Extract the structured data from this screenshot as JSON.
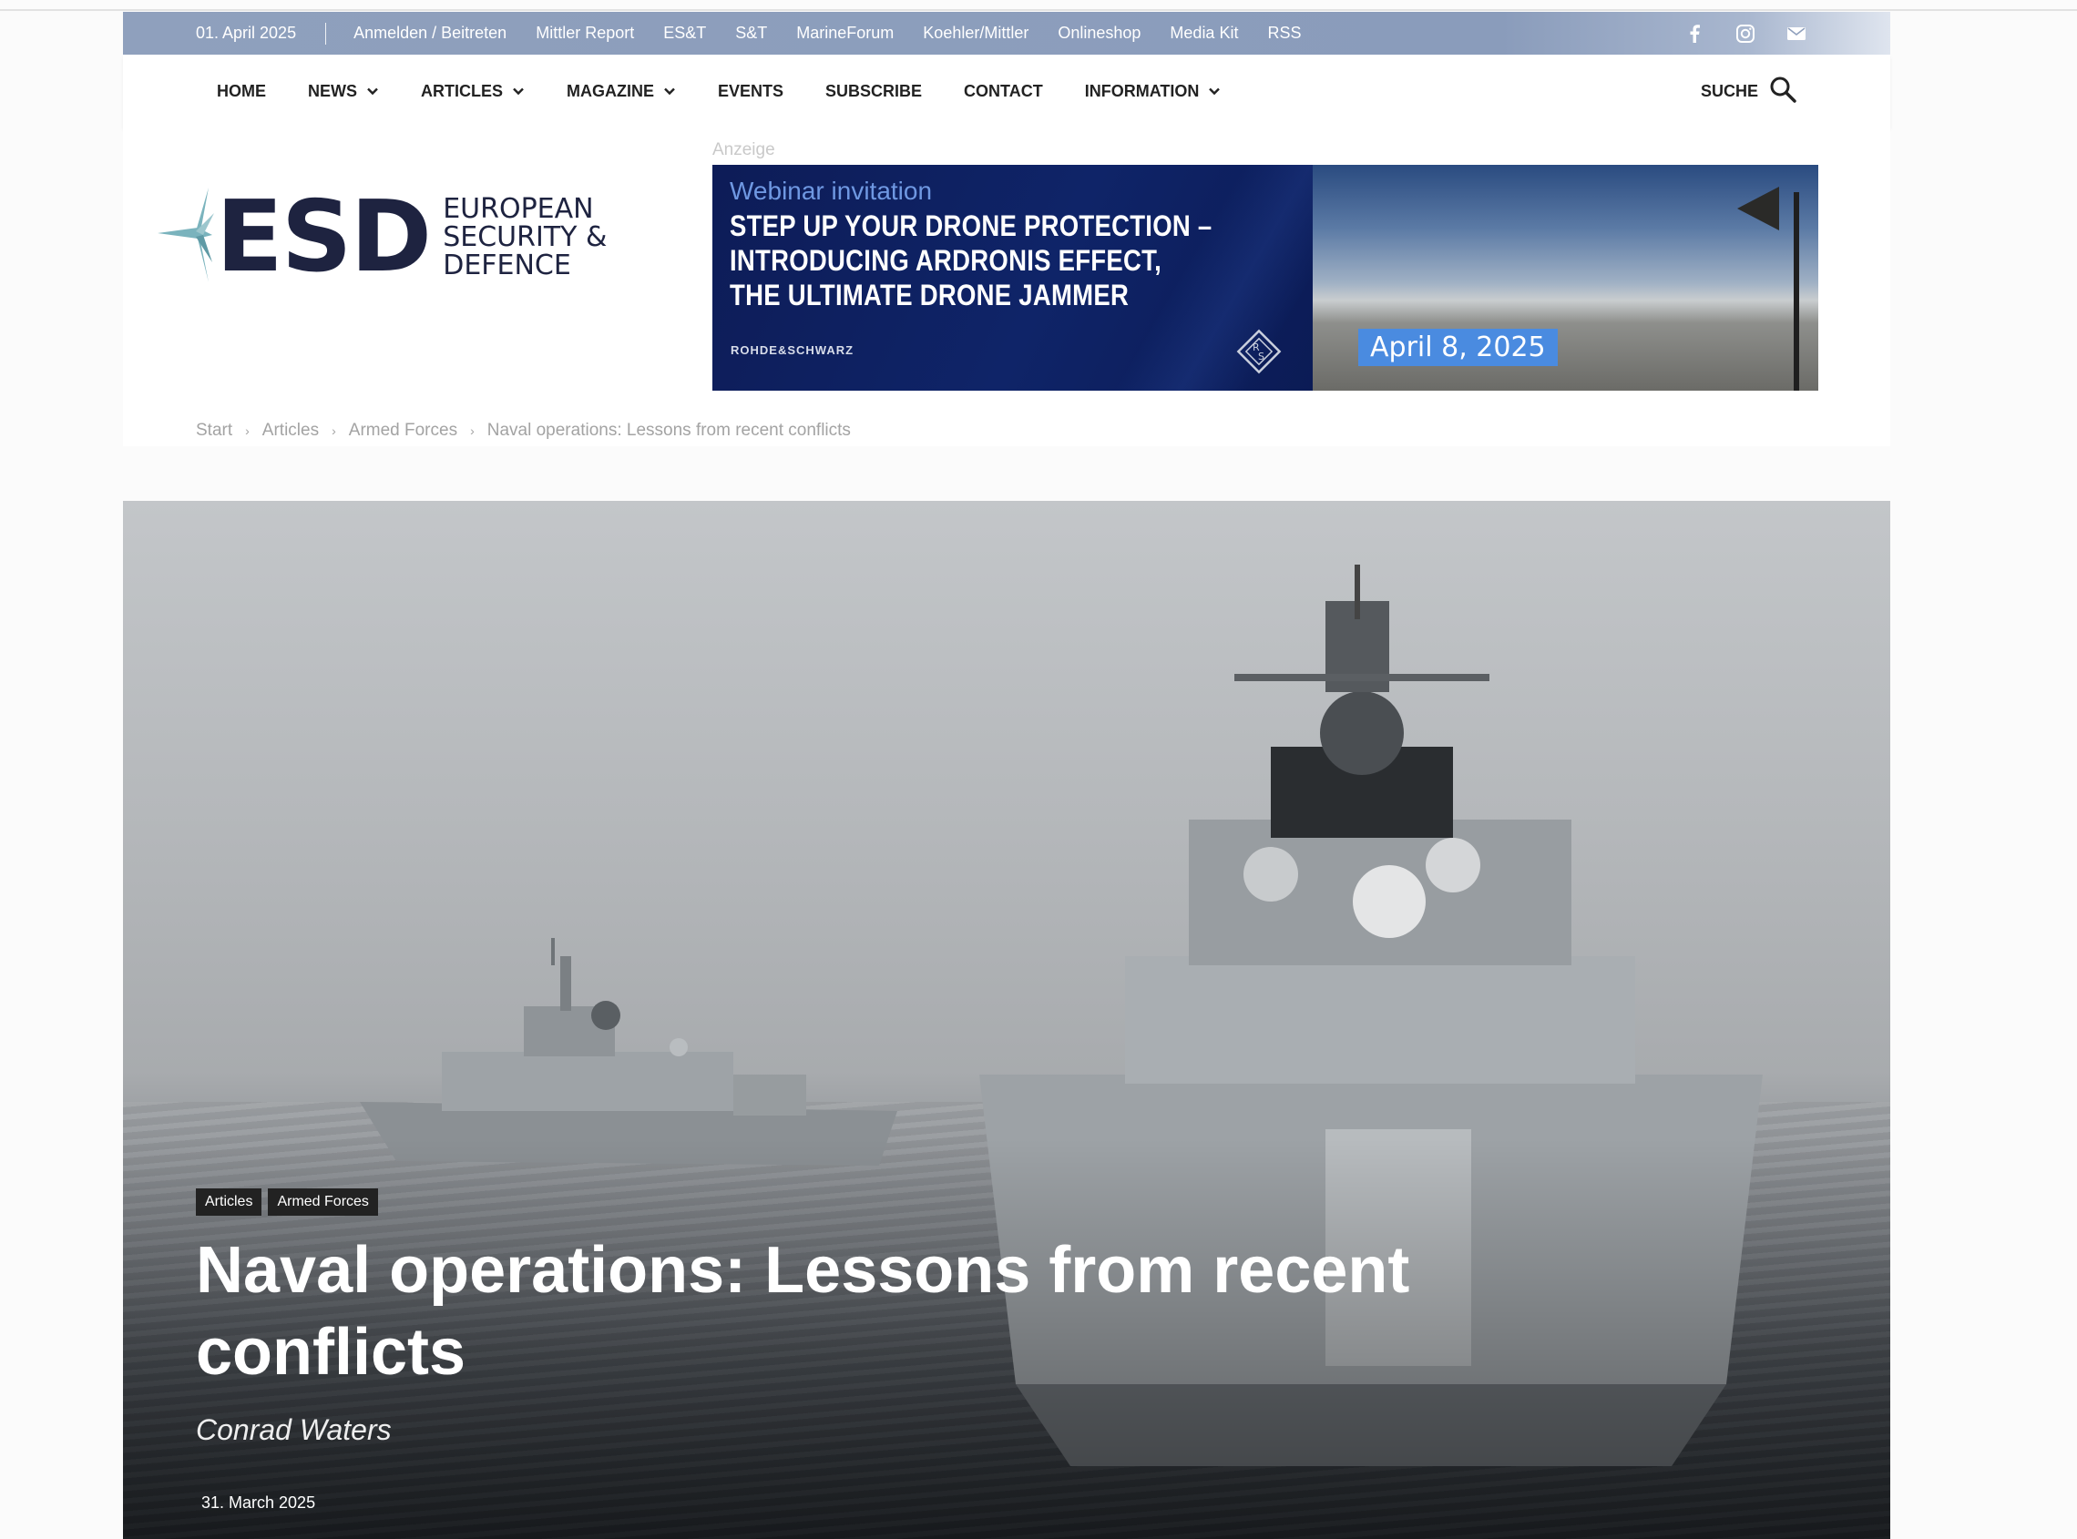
{
  "topbar": {
    "date": "01. April 2025",
    "links": [
      "Anmelden / Beitreten",
      "Mittler Report",
      "ES&T",
      "S&T",
      "MarineForum",
      "Koehler/Mittler",
      "Onlineshop",
      "Media Kit",
      "RSS"
    ],
    "social_icons": [
      "facebook-icon",
      "instagram-icon",
      "mail-icon"
    ]
  },
  "nav": {
    "items": [
      {
        "label": "HOME",
        "dropdown": false
      },
      {
        "label": "NEWS",
        "dropdown": true
      },
      {
        "label": "ARTICLES",
        "dropdown": true
      },
      {
        "label": "MAGAZINE",
        "dropdown": true
      },
      {
        "label": "EVENTS",
        "dropdown": false
      },
      {
        "label": "SUBSCRIBE",
        "dropdown": false
      },
      {
        "label": "CONTACT",
        "dropdown": false
      },
      {
        "label": "INFORMATION",
        "dropdown": true
      }
    ],
    "search_label": "SUCHE"
  },
  "logo": {
    "abbr": "ESD",
    "line1": "EUROPEAN",
    "line2": "SECURITY &",
    "line3": "DEFENCE"
  },
  "ad": {
    "label": "Anzeige",
    "kicker": "Webinar invitation",
    "headline_1": "STEP UP YOUR DRONE PROTECTION –",
    "headline_2": "INTRODUCING ARDRONIS EFFECT,",
    "headline_3": "THE ULTIMATE DRONE JAMMER",
    "brand": "ROHDE&SCHWARZ",
    "event_date": "April 8, 2025"
  },
  "breadcrumb": {
    "items": [
      "Start",
      "Articles",
      "Armed Forces",
      "Naval operations: Lessons from recent conflicts"
    ]
  },
  "article": {
    "categories": [
      "Articles",
      "Armed Forces"
    ],
    "title": "Naval operations: Lessons from recent conflicts",
    "author": "Conrad Waters",
    "date": "31. March 2025"
  },
  "colors": {
    "topbar": "#8fa0bd",
    "brand_navy": "#1e2340",
    "logo_accent": "#7ab3bd",
    "ad_blue": "#0f2468",
    "ad_date": "#4a8be0"
  }
}
